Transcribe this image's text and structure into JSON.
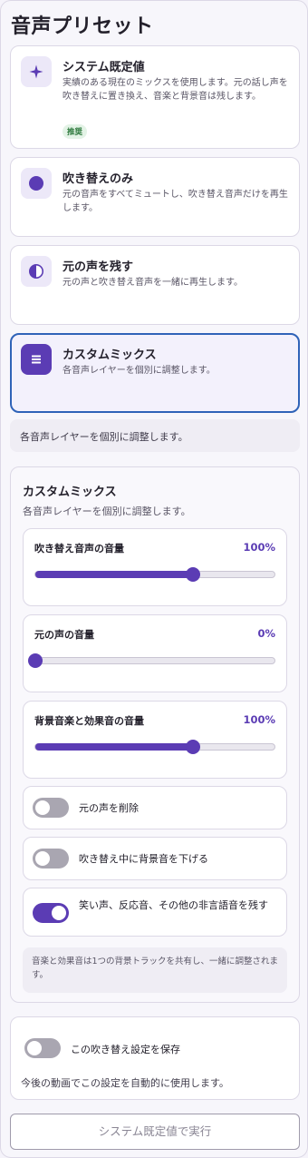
{
  "page_title": "音声プリセット",
  "presets": [
    {
      "title": "システム既定値",
      "description": "実績のある現在のミックスを使用します。元の話し声を吹き替えに置き換え、音楽と背景音は残します。",
      "badge": "推奨",
      "icon": "sparkle-icon",
      "selected": false
    },
    {
      "title": "吹き替えのみ",
      "description": "元の音声をすべてミュートし、吹き替え音声だけを再生します。",
      "icon": "filled-circle-icon",
      "selected": false
    },
    {
      "title": "元の声を残す",
      "description": "元の声と吹き替え音声を一緒に再生します。",
      "icon": "half-circle-icon",
      "selected": false
    },
    {
      "title": "カスタムミックス",
      "description": "各音声レイヤーを個別に調整します。",
      "icon": "layers-icon",
      "selected": true
    }
  ],
  "info_strip": "各音声レイヤーを個別に調整します。",
  "custom_panel": {
    "title": "カスタムミックス",
    "subtitle": "各音声レイヤーを個別に調整します。",
    "sliders": [
      {
        "label": "吹き替え音声の音量",
        "value_text": "100%",
        "level": 0.66
      },
      {
        "label": "元の声の音量",
        "value_text": "0%",
        "level": 0.0
      },
      {
        "label": "背景音楽と効果音の音量",
        "value_text": "100%",
        "level": 0.66
      }
    ],
    "toggles": [
      {
        "label": "元の声を削除",
        "on": false
      },
      {
        "label": "吹き替え中に背景音を下げる",
        "on": false
      },
      {
        "label": "笑い声、反応音、その他の非言語音を残す",
        "on": true
      }
    ],
    "note": "音楽と効果音は1つの背景トラックを共有し、一緒に調整されます。"
  },
  "save": {
    "label": "この吹き替え設定を保存",
    "on": false,
    "hint": "今後の動画でこの設定を自動的に使用します。"
  },
  "run_button": "システム既定値で実行",
  "colors": {
    "accent": "#5b3cb4",
    "selected_border": "#2f63b8",
    "badge_bg": "#e3f3e6",
    "badge_text": "#2f7a3e",
    "toggle_off": "#a9a6b1"
  }
}
